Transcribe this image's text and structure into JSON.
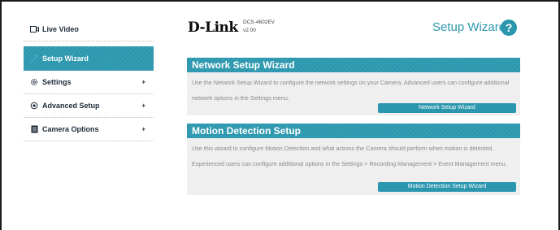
{
  "sidebar": {
    "items": [
      {
        "label": "Live Video",
        "icon": "video-icon",
        "expandable": false
      },
      {
        "label": "Setup Wizard",
        "icon": "wand-icon",
        "expandable": false
      },
      {
        "label": "Settings",
        "icon": "gear-icon",
        "expandable": true
      },
      {
        "label": "Advanced Setup",
        "icon": "advanced-gear-icon",
        "expandable": true
      },
      {
        "label": "Camera Options",
        "icon": "document-icon",
        "expandable": true
      }
    ],
    "plus": "+"
  },
  "header": {
    "logo": "D-Link",
    "model": "DCS-4602EV",
    "version": "v2.00",
    "title": "Setup Wizard",
    "help": "?"
  },
  "network": {
    "title": "Network Setup Wizard",
    "text": "Use the Network Setup Wizard to configure the network settings on your Camera. Advanced users can configure additional network options in the Settings menu.",
    "button": "Network Setup Wizard"
  },
  "motion": {
    "title": "Motion Detection Setup",
    "text": "Use this wizard to configure Motion Detection and what actions the Camera should perform when motion is detected. Experienced users can configure additional options in the Settings > Recording Management > Event Management menu.",
    "button": "Motion Detection Setup Wizard"
  },
  "colors": {
    "accent": "#2b97ae",
    "panel": "#efefef",
    "text": "#8a8a8a"
  }
}
